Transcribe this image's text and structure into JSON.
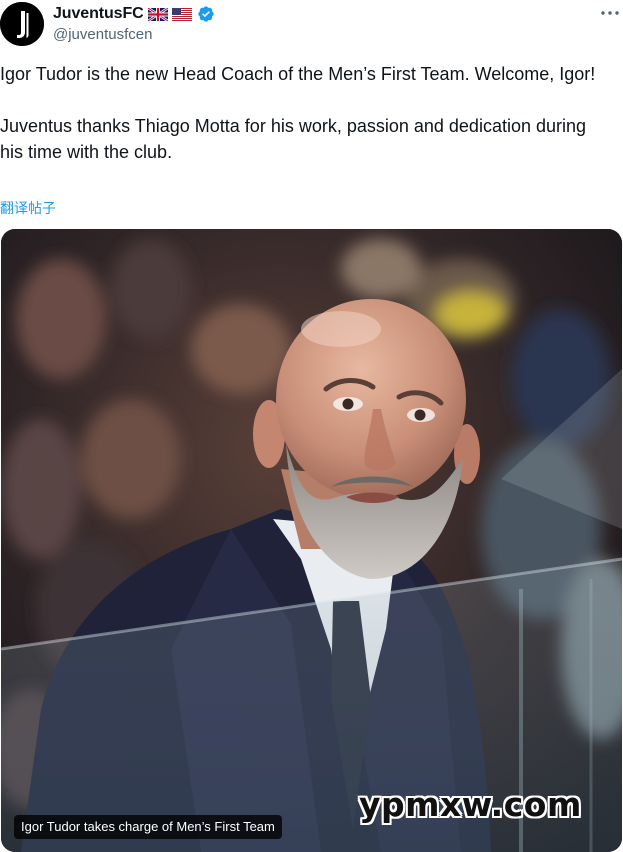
{
  "author": {
    "display_name": "JuventusFC",
    "handle": "@juventusfcen",
    "flags": [
      "uk-flag-icon",
      "us-flag-icon"
    ],
    "verified_icon": "verified-badge-icon",
    "avatar_icon": "juventus-logo-icon"
  },
  "header": {
    "more_icon": "more-options-icon"
  },
  "tweet": {
    "text": "Igor Tudor is the new Head Coach of the Men’s First Team. Welcome, Igor!\n\nJuventus thanks Thiago Motta for his work, passion and dedication during his time with the club.",
    "translate_label": "翻译帖子"
  },
  "media": {
    "caption": "Igor Tudor takes charge of Men’s First Team",
    "watermark": "ypmxw.com"
  },
  "colors": {
    "link": "#1d9bf0",
    "verified": "#1d9bf0",
    "secondary_text": "#536471",
    "primary_text": "#0f1419"
  }
}
